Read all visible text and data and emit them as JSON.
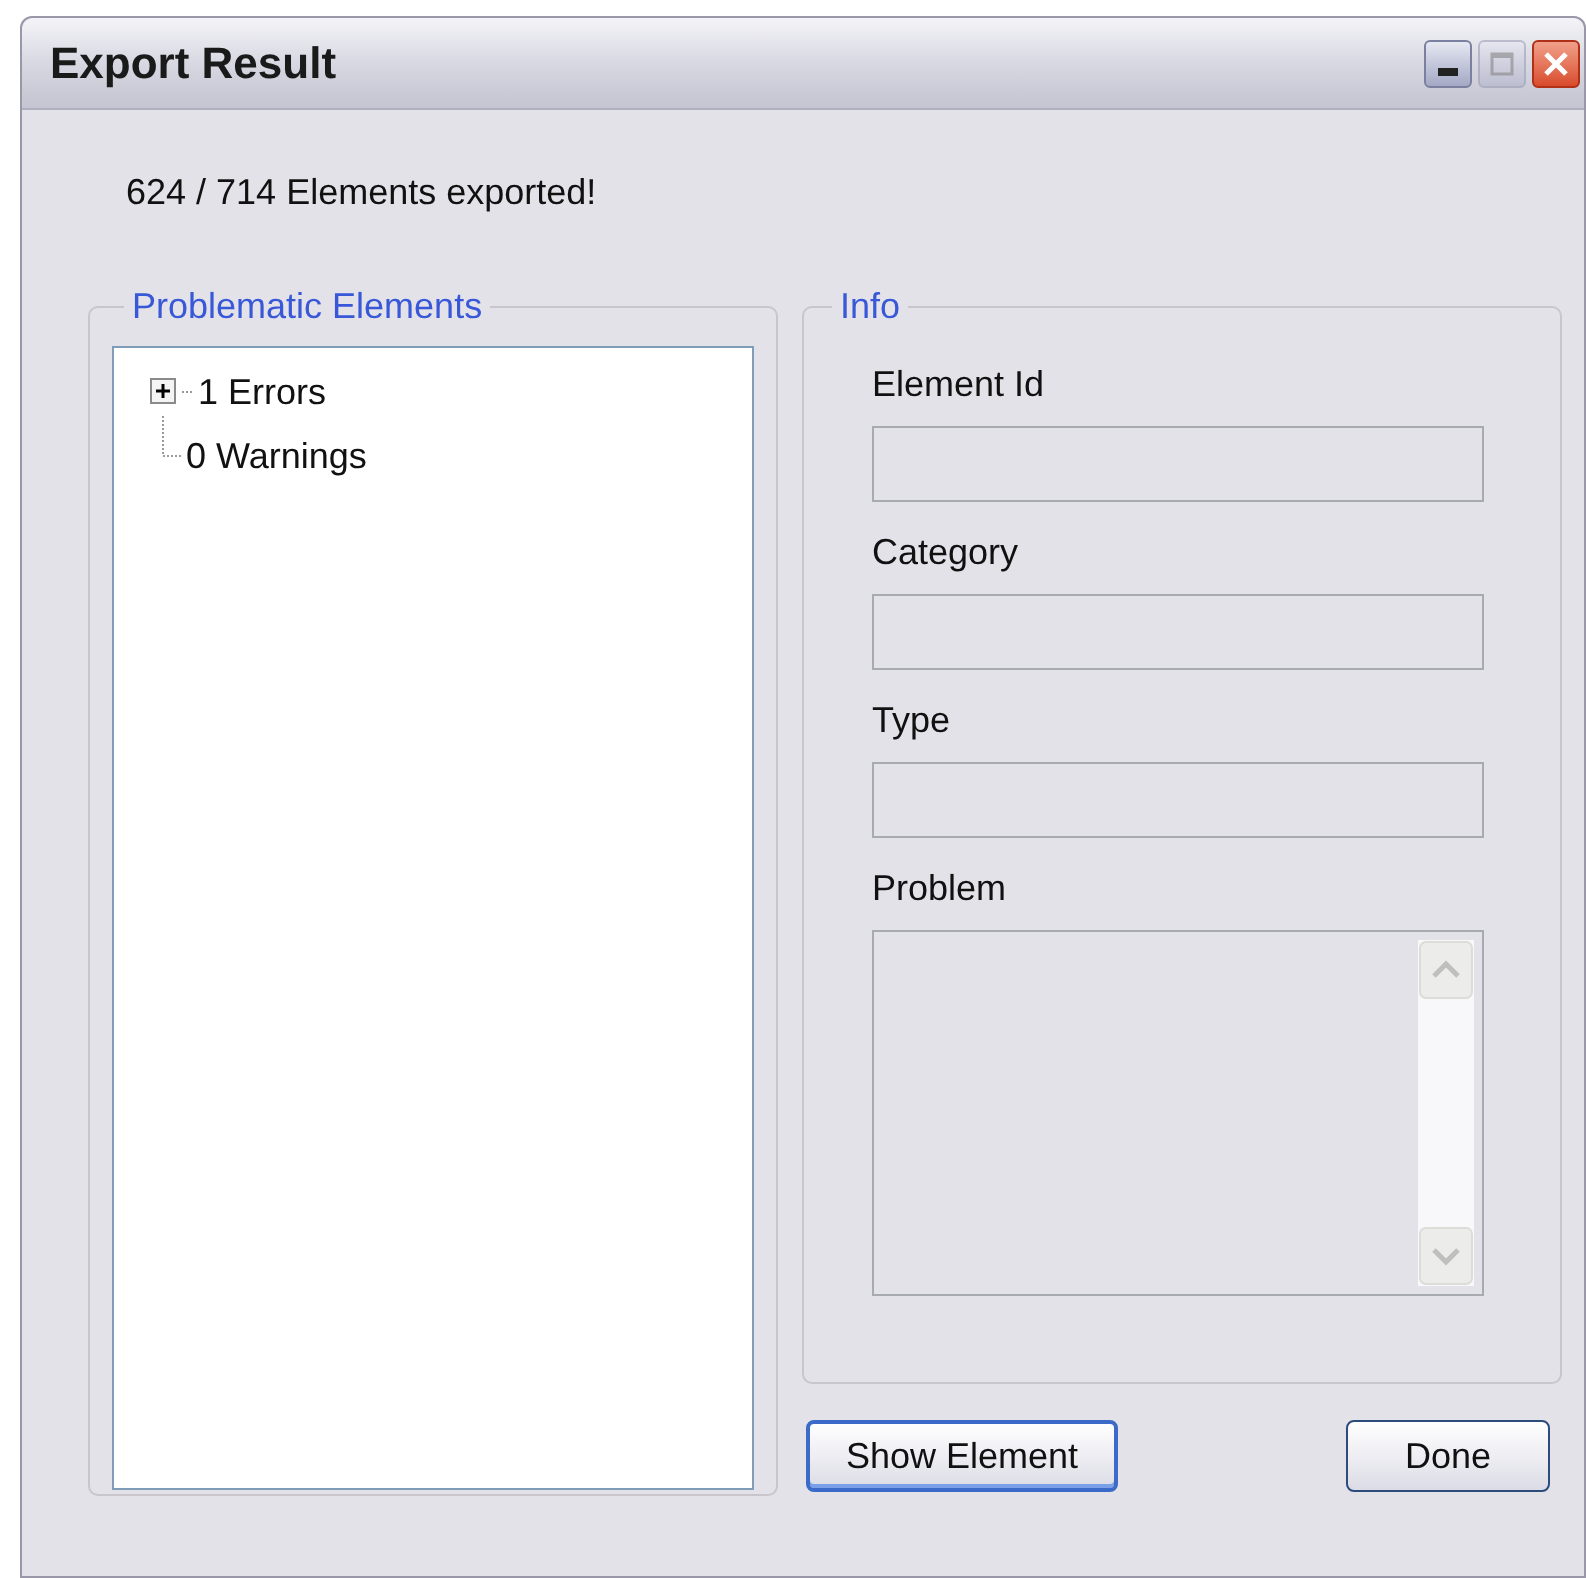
{
  "window": {
    "title": "Export Result",
    "controls": [
      {
        "kind": "minimize",
        "disabled": false
      },
      {
        "kind": "maximize",
        "disabled": true
      },
      {
        "kind": "close",
        "disabled": false
      }
    ]
  },
  "message": "624 / 714 Elements exported!",
  "problems": {
    "title": "Problematic Elements",
    "items": [
      {
        "label": "1 Errors",
        "expanded": false
      },
      {
        "label": "0 Warnings"
      }
    ]
  },
  "info": {
    "title": "Info",
    "fields": [
      {
        "label": "Element Id",
        "kind": "text"
      },
      {
        "label": "Category",
        "kind": "text"
      },
      {
        "label": "Type",
        "kind": "text"
      },
      {
        "label": "Problem",
        "kind": "textarea"
      }
    ]
  },
  "buttons": [
    {
      "label": "Show Element",
      "focused": true
    },
    {
      "label": "Done",
      "focused": false
    }
  ]
}
